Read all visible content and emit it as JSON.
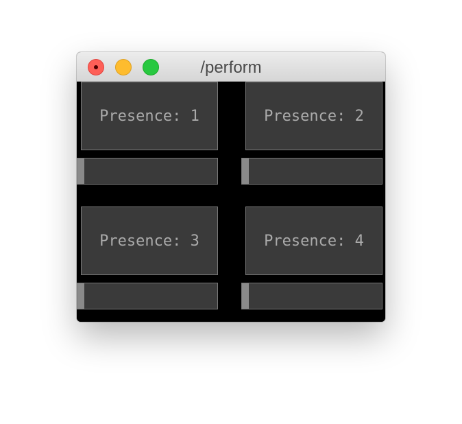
{
  "window": {
    "title": "/perform"
  },
  "panels": [
    {
      "label": "Presence: 1",
      "slider_value": 0
    },
    {
      "label": "Presence: 2",
      "slider_value": 0
    },
    {
      "label": "Presence: 3",
      "slider_value": 0
    },
    {
      "label": "Presence: 4",
      "slider_value": 0
    }
  ],
  "colors": {
    "window_background": "#000000",
    "control_fill": "#3a3a3a",
    "control_border": "#7a7a7a",
    "label_text": "#aaaaaa",
    "slider_handle": "#8a8a8a"
  }
}
